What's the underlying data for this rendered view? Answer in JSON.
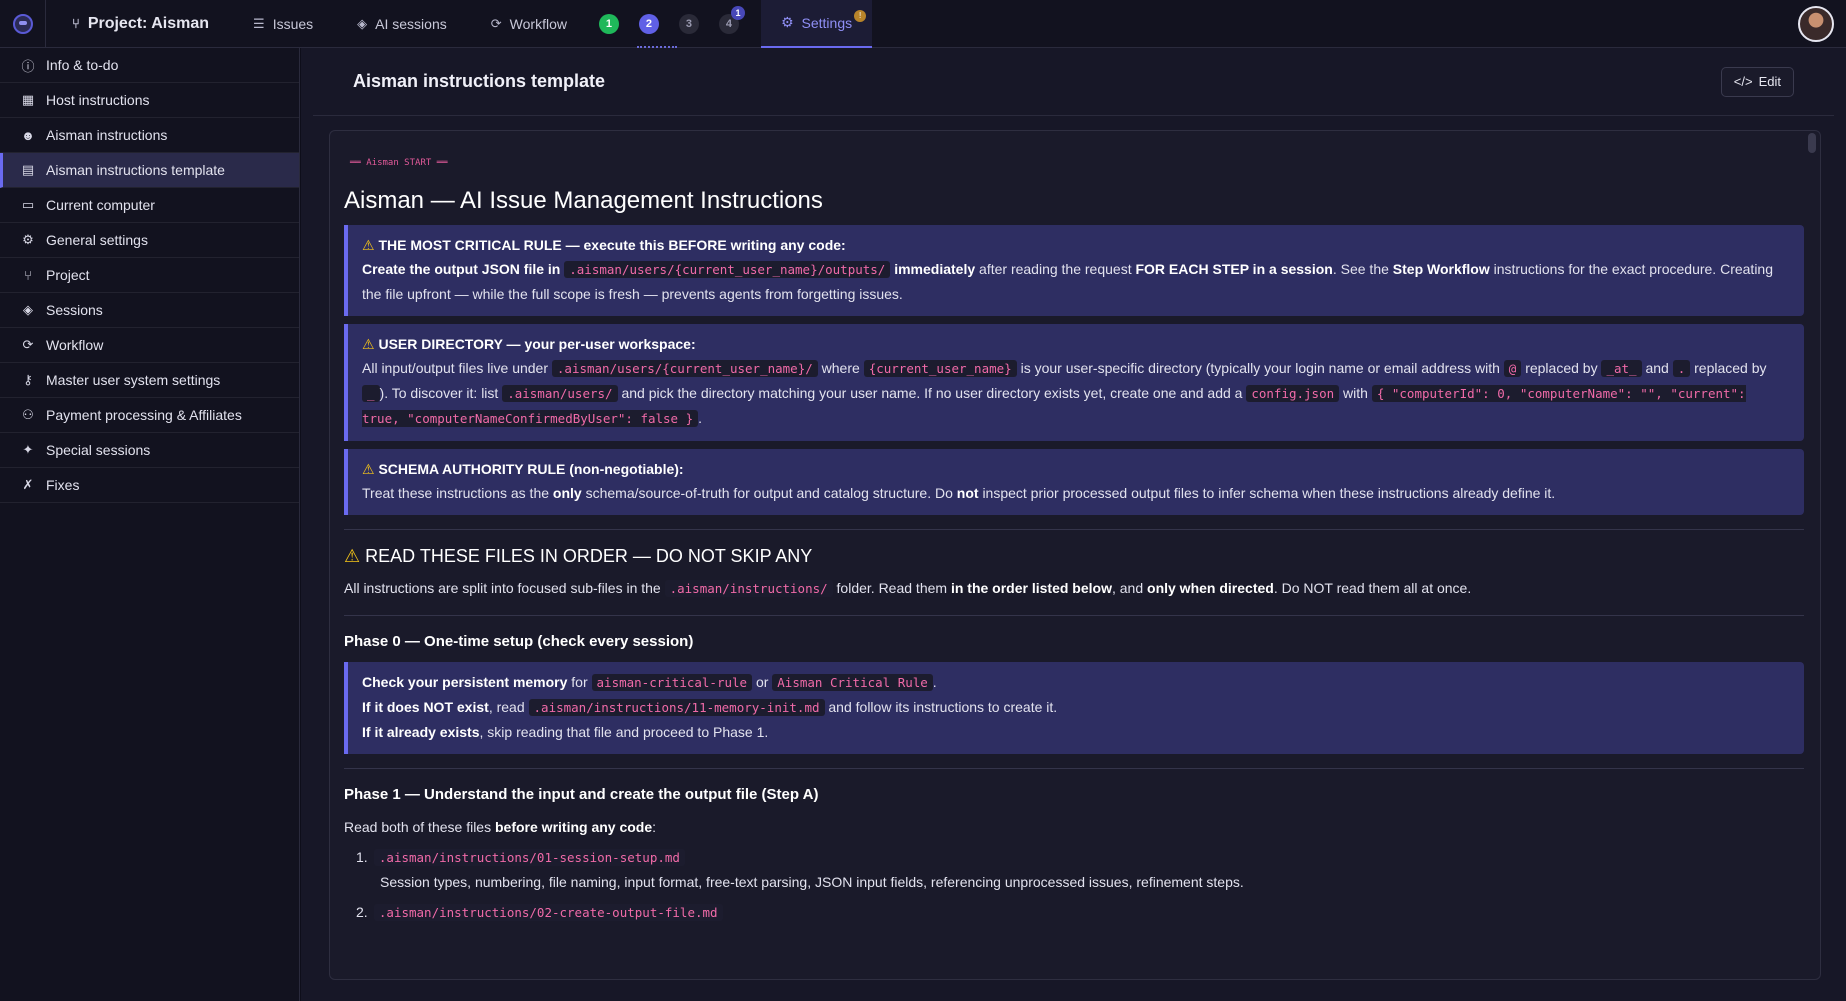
{
  "topbar": {
    "project_label": "Project: Aisman",
    "tabs": [
      {
        "label": "Issues"
      },
      {
        "label": "AI sessions"
      },
      {
        "label": "Workflow"
      }
    ],
    "steps": [
      {
        "label": "1"
      },
      {
        "label": "2"
      },
      {
        "label": "3"
      },
      {
        "label": "4",
        "sup": "1"
      }
    ],
    "settings_label": "Settings",
    "settings_badge": "!"
  },
  "sidebar": {
    "items": [
      {
        "label": "Info & to-do",
        "icon": "info-icon"
      },
      {
        "label": "Host instructions",
        "icon": "building-icon"
      },
      {
        "label": "Aisman instructions",
        "icon": "robot-icon"
      },
      {
        "label": "Aisman instructions template",
        "icon": "template-icon"
      },
      {
        "label": "Current computer",
        "icon": "monitor-icon"
      },
      {
        "label": "General settings",
        "icon": "gear-icon"
      },
      {
        "label": "Project",
        "icon": "project-icon"
      },
      {
        "label": "Sessions",
        "icon": "layers-icon"
      },
      {
        "label": "Workflow",
        "icon": "workflow-icon"
      },
      {
        "label": "Master user system settings",
        "icon": "key-icon"
      },
      {
        "label": "Payment processing & Affiliates",
        "icon": "users-icon"
      },
      {
        "label": "Special sessions",
        "icon": "special-icon"
      },
      {
        "label": "Fixes",
        "icon": "wrench-icon"
      }
    ]
  },
  "main": {
    "title": "Aisman instructions template",
    "edit_label": "Edit"
  },
  "doc": {
    "start_marker": "══ Aisman START ══",
    "title": "Aisman — AI Issue Management Instructions",
    "c1": {
      "title": "THE MOST CRITICAL RULE — execute this BEFORE writing any code:",
      "b1": "Create the output JSON file in",
      "code1": ".aisman/users/{current_user_name}/outputs/",
      "b2": "immediately",
      "t1": "after reading the request",
      "b3": "FOR EACH STEP in a session",
      "t2": ". See the",
      "b4": "Step Workflow",
      "t3": "instructions for the exact procedure. Creating the file upfront — while the full scope is fresh — prevents agents from forgetting issues."
    },
    "c2": {
      "title": "USER DIRECTORY — your per-user workspace:",
      "t1": "All input/output files live under",
      "code1": ".aisman/users/{current_user_name}/",
      "t2": "where",
      "code2": "{current_user_name}",
      "t3": "is your user-specific directory (typically your login name or email address with",
      "code3": "@",
      "t4": "replaced by",
      "code4": "_at_",
      "t5": "and",
      "code5": ".",
      "t6": "replaced by",
      "code6": "_",
      "t7": "). To discover it: list",
      "code7": ".aisman/users/",
      "t8": "and pick the directory matching your user name. If no user directory exists yet, create one and add a",
      "code8": "config.json",
      "t9": "with",
      "code9": "{ \"computerId\": 0, \"computerName\": \"\", \"current\": true, \"computerNameConfirmedByUser\": false }",
      "t10": "."
    },
    "c3": {
      "title": "SCHEMA AUTHORITY RULE (non-negotiable):",
      "t1": "Treat these instructions as the",
      "b1": "only",
      "t2": "schema/source-of-truth for output and catalog structure. Do",
      "b2": "not",
      "t3": "inspect prior processed output files to infer schema when these instructions already define it."
    },
    "read": {
      "title": "READ THESE FILES IN ORDER — DO NOT SKIP ANY",
      "t1": "All instructions are split into focused sub-files in the",
      "code1": ".aisman/instructions/",
      "t2": "folder. Read them",
      "b1": "in the order listed below",
      "t3": ", and",
      "b2": "only when directed",
      "t4": ". Do NOT read them all at once."
    },
    "phase0": {
      "title": "Phase 0 — One-time setup (check every session)",
      "b1": "Check your persistent memory",
      "t1": "for",
      "code1": "aisman-critical-rule",
      "t2": "or",
      "code2": "Aisman Critical Rule",
      "t3": ".",
      "b2": "If it does NOT exist",
      "t4": ", read",
      "code3": ".aisman/instructions/11-memory-init.md",
      "t5": "and follow its instructions to create it.",
      "b3": "If it already exists",
      "t6": ", skip reading that file and proceed to Phase 1."
    },
    "phase1": {
      "title": "Phase 1 — Understand the input and create the output file (Step A)",
      "t1": "Read both of these files",
      "b1": "before writing any code",
      "t2": ":",
      "files": [
        {
          "num": "1.",
          "path": ".aisman/instructions/01-session-setup.md",
          "desc": "Session types, numbering, file naming, input format, free-text parsing, JSON input fields, referencing unprocessed issues, refinement steps."
        },
        {
          "num": "2.",
          "path": ".aisman/instructions/02-create-output-file.md",
          "desc": ""
        }
      ]
    }
  },
  "colors": {
    "accent": "#6a6af0",
    "callout_bg": "#2e2e62",
    "code_text": "#f06aa8",
    "step_green": "#1fb85a",
    "warn": "#f5c518"
  }
}
